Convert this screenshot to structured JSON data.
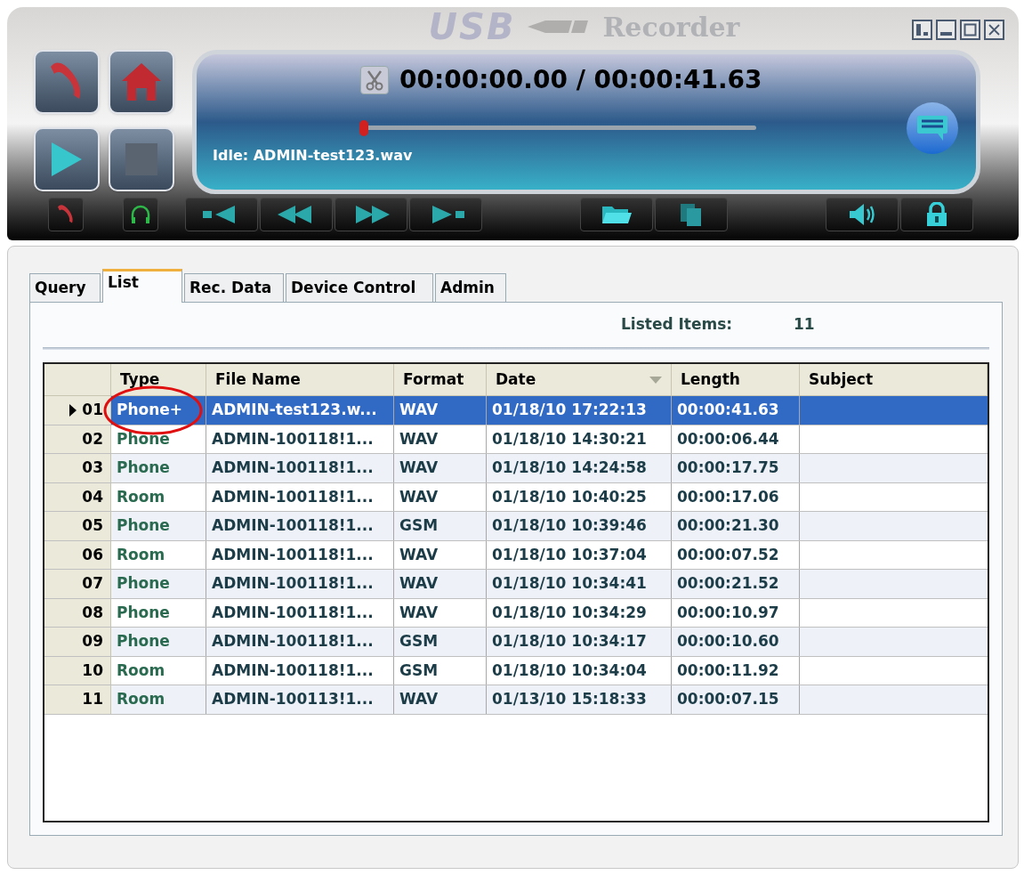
{
  "window": {
    "logo": "USB",
    "title": "Recorder"
  },
  "player": {
    "time": "00:00:00.00 / 00:00:41.63",
    "position": {
      "level": 0.0
    },
    "status": "Idle: ADMIN-test123.wav"
  },
  "tabs": [
    {
      "label": "Query",
      "selected": false
    },
    {
      "label": "List",
      "selected": true
    },
    {
      "label": "Rec. Data",
      "selected": false
    },
    {
      "label": "Device Control",
      "selected": false
    },
    {
      "label": "Admin",
      "selected": false
    }
  ],
  "listed_items": {
    "label": "Listed Items:",
    "value": "11"
  },
  "table": {
    "columns": [
      {
        "label": "Type",
        "sorted": false
      },
      {
        "label": "File Name",
        "sorted": false
      },
      {
        "label": "Format",
        "sorted": false
      },
      {
        "label": "Date",
        "sorted": true
      },
      {
        "label": "Length",
        "sorted": false
      },
      {
        "label": "Subject",
        "sorted": false
      }
    ],
    "rows": [
      {
        "num": "01",
        "type": "Phone+",
        "file_name": "ADMIN-test123.w...",
        "format": "WAV",
        "date": "01/18/10 17:22:13",
        "length": "00:00:41.63",
        "selected": true,
        "circled": true
      },
      {
        "num": "02",
        "type": "Phone",
        "file_name": "ADMIN-100118!1...",
        "format": "WAV",
        "date": "01/18/10 14:30:21",
        "length": "00:00:06.44",
        "selected": false,
        "circled": false
      },
      {
        "num": "03",
        "type": "Phone",
        "file_name": "ADMIN-100118!1...",
        "format": "WAV",
        "date": "01/18/10 14:24:58",
        "length": "00:00:17.75",
        "selected": false,
        "circled": false
      },
      {
        "num": "04",
        "type": "Room",
        "file_name": "ADMIN-100118!1...",
        "format": "WAV",
        "date": "01/18/10 10:40:25",
        "length": "00:00:17.06",
        "selected": false,
        "circled": false
      },
      {
        "num": "05",
        "type": "Phone",
        "file_name": "ADMIN-100118!1...",
        "format": "GSM",
        "date": "01/18/10 10:39:46",
        "length": "00:00:21.30",
        "selected": false,
        "circled": false
      },
      {
        "num": "06",
        "type": "Room",
        "file_name": "ADMIN-100118!1...",
        "format": "WAV",
        "date": "01/18/10 10:37:04",
        "length": "00:00:07.52",
        "selected": false,
        "circled": false
      },
      {
        "num": "07",
        "type": "Phone",
        "file_name": "ADMIN-100118!1...",
        "format": "WAV",
        "date": "01/18/10 10:34:41",
        "length": "00:00:21.52",
        "selected": false,
        "circled": false
      },
      {
        "num": "08",
        "type": "Phone",
        "file_name": "ADMIN-100118!1...",
        "format": "WAV",
        "date": "01/18/10 10:34:29",
        "length": "00:00:10.97",
        "selected": false,
        "circled": false
      },
      {
        "num": "09",
        "type": "Phone",
        "file_name": "ADMIN-100118!1...",
        "format": "GSM",
        "date": "01/18/10 10:34:17",
        "length": "00:00:10.60",
        "selected": false,
        "circled": false
      },
      {
        "num": "10",
        "type": "Room",
        "file_name": "ADMIN-100118!1...",
        "format": "GSM",
        "date": "01/18/10 10:34:04",
        "length": "00:00:11.92",
        "selected": false,
        "circled": false
      },
      {
        "num": "11",
        "type": "Room",
        "file_name": "ADMIN-100113!1...",
        "format": "WAV",
        "date": "01/13/10 15:18:33",
        "length": "00:00:07.15",
        "selected": false,
        "circled": false
      }
    ]
  }
}
